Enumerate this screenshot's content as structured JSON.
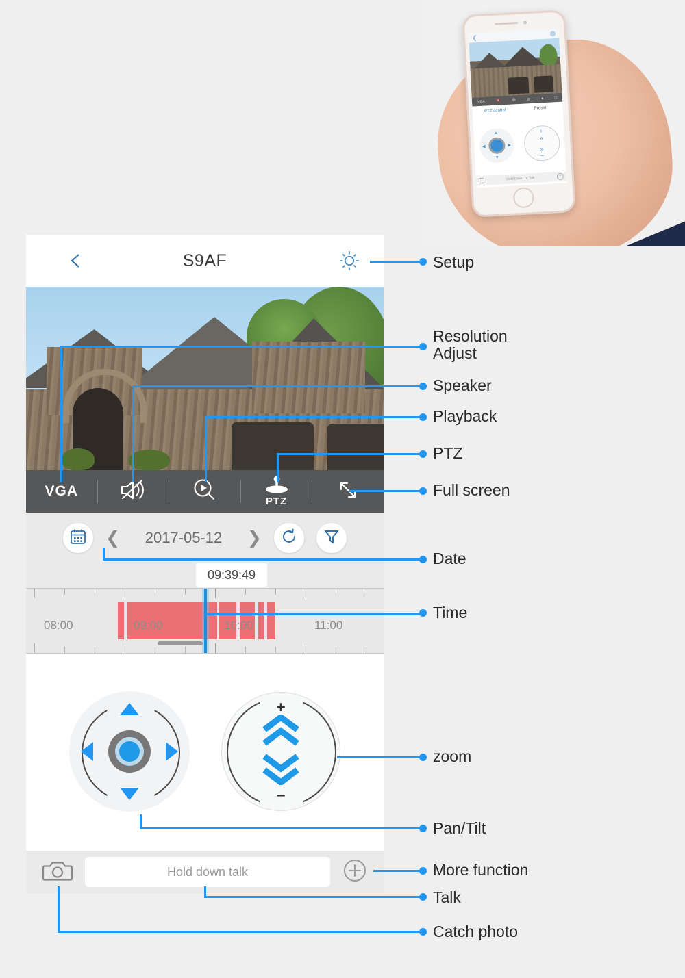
{
  "photo": {
    "alt_scene": "hand-holding-iphone",
    "phone_app": {
      "tab_ptz": "PTZ control",
      "tab_preset": "Preset",
      "toolbar": [
        "VGA",
        "mute-icon",
        "eye-icon",
        "playback-icon",
        "ptz-icon",
        "fullscreen-icon"
      ],
      "talk_label": "Hold Down To Talk",
      "zoom_plus": "+",
      "zoom_minus": "−"
    }
  },
  "app": {
    "header": {
      "back_icon": "chevron-left-icon",
      "title": "S9AF",
      "settings_icon": "gear-icon"
    },
    "toolbar": {
      "resolution_label": "VGA",
      "speaker_icon": "speaker-muted-icon",
      "playback_icon": "playback-search-icon",
      "ptz_label": "PTZ",
      "ptz_icon": "joystick-icon",
      "fullscreen_icon": "fullscreen-arrows-icon"
    },
    "datebar": {
      "calendar_icon": "calendar-icon",
      "prev_icon": "chevron-left-icon",
      "date": "2017-05-12",
      "next_icon": "chevron-right-icon",
      "refresh_icon": "refresh-icon",
      "filter_icon": "filter-icon"
    },
    "timeline": {
      "tooltip_time": "09:39:49",
      "hour_labels": [
        "08:00",
        "09:00",
        "10:00",
        "11:00"
      ],
      "segment_color": "#ec6f73",
      "playhead_color": "#1a8fe0"
    },
    "ptz": {
      "pad_name": "pan-tilt-pad",
      "zoom_plus": "+",
      "zoom_minus": "−"
    },
    "bottom": {
      "snapshot_icon": "camera-icon",
      "talk_label": "Hold down talk",
      "more_icon": "plus-circle-icon"
    }
  },
  "annotations": [
    {
      "label": "Setup"
    },
    {
      "label": "Resolution\nAdjust"
    },
    {
      "label": "Speaker"
    },
    {
      "label": "Playback"
    },
    {
      "label": "PTZ"
    },
    {
      "label": "Full screen"
    },
    {
      "label": "Date"
    },
    {
      "label": "Time"
    },
    {
      "label": "zoom"
    },
    {
      "label": "Pan/Tilt"
    },
    {
      "label": "More function"
    },
    {
      "label": "Talk"
    },
    {
      "label": "Catch photo"
    }
  ],
  "colors": {
    "accent": "#2196f3",
    "toolbar_bg": "#555759",
    "panel_bg": "#eaeaea",
    "record_red": "#ec6f73"
  }
}
